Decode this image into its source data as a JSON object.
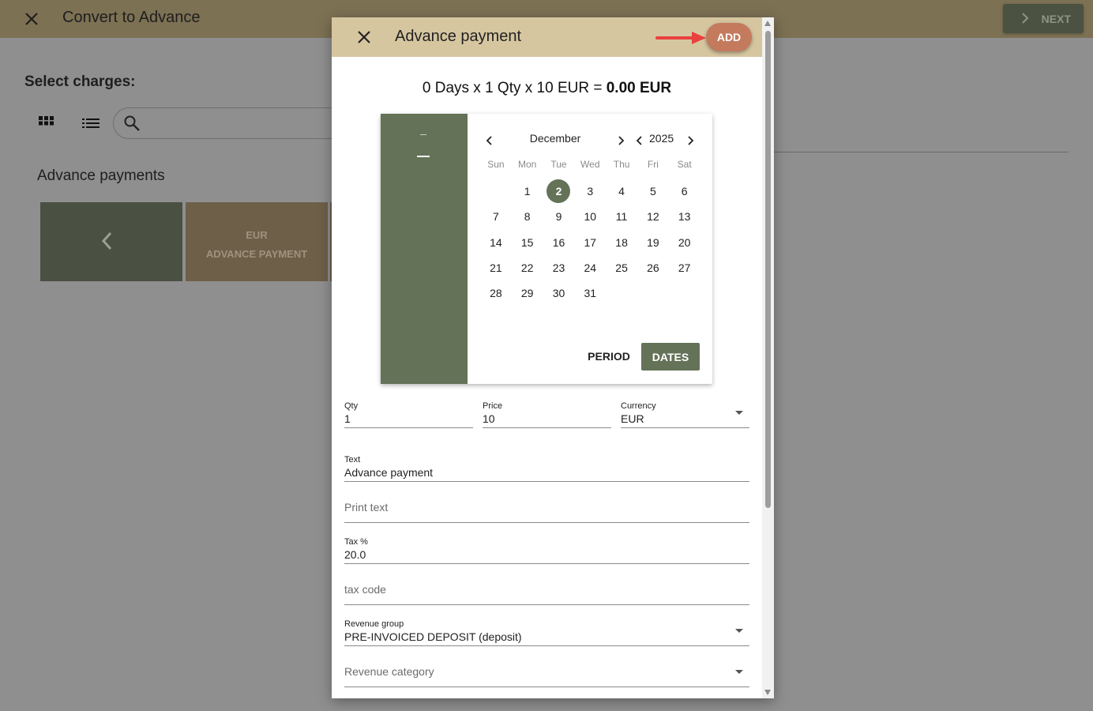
{
  "background": {
    "title": "Convert to Advance",
    "next_label": "NEXT",
    "section_label": "Select charges:",
    "advance_heading": "Advance payments",
    "tile_currency": "EUR",
    "tile_label": "ADVANCE PAYMENT"
  },
  "dialog": {
    "title": "Advance payment",
    "add_label": "ADD",
    "formula": {
      "prefix": "0 Days x 1 Qty x 10 EUR = ",
      "total": "0.00 EUR"
    },
    "picker": {
      "month": "December",
      "year": "2025",
      "selected_day": 2,
      "weekdays": [
        "Sun",
        "Mon",
        "Tue",
        "Wed",
        "Thu",
        "Fri",
        "Sat"
      ],
      "days": [
        "",
        "1",
        "2",
        "3",
        "4",
        "5",
        "6",
        "7",
        "8",
        "9",
        "10",
        "11",
        "12",
        "13",
        "14",
        "15",
        "16",
        "17",
        "18",
        "19",
        "20",
        "21",
        "22",
        "23",
        "24",
        "25",
        "26",
        "27",
        "28",
        "29",
        "30",
        "31"
      ],
      "period_label": "PERIOD",
      "dates_label": "DATES"
    },
    "fields": {
      "qty": {
        "label": "Qty",
        "value": "1"
      },
      "price": {
        "label": "Price",
        "value": "10"
      },
      "currency": {
        "label": "Currency",
        "value": "EUR"
      },
      "text": {
        "label": "Text",
        "value": "Advance payment"
      },
      "print_text": {
        "placeholder": "Print text"
      },
      "tax": {
        "label": "Tax %",
        "value": "20.0"
      },
      "tax_code": {
        "placeholder": "tax code"
      },
      "revenue_group": {
        "label": "Revenue group",
        "value": "PRE-INVOICED DEPOSIT (deposit)"
      },
      "revenue_category": {
        "placeholder": "Revenue category"
      }
    }
  },
  "colors": {
    "header": "#d6c6a0",
    "accent_green": "#647258",
    "add_button": "#c47a5d",
    "arrow": "#e8423f"
  }
}
